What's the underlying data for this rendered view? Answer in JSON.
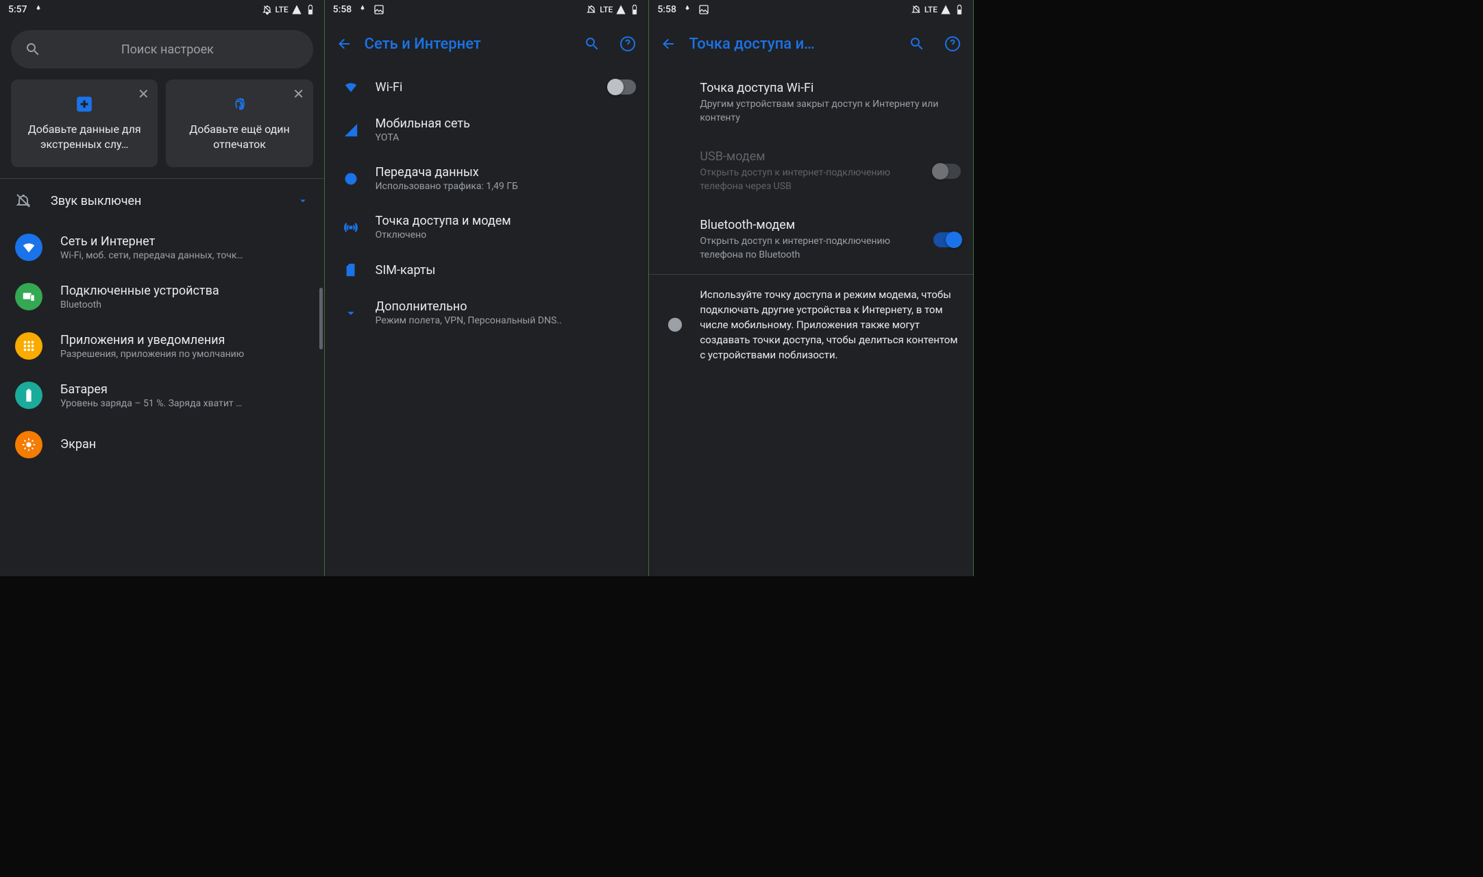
{
  "screen1": {
    "status": {
      "time": "5:57",
      "network": "LTE"
    },
    "search_placeholder": "Поиск настроек",
    "cards": [
      {
        "title": "Добавьте данные для экстренных слу…"
      },
      {
        "title": "Добавьте ещё один отпечаток"
      }
    ],
    "mute_label": "Звук выключен",
    "items": [
      {
        "title": "Сеть и Интернет",
        "sub": "Wi-Fi, моб. сети, передача данных, точк…",
        "color": "#1a73e8",
        "icon": "wifi"
      },
      {
        "title": "Подключенные устройства",
        "sub": "Bluetooth",
        "color": "#34a853",
        "icon": "devices"
      },
      {
        "title": "Приложения и уведомления",
        "sub": "Разрешения, приложения по умолчанию",
        "color": "#f9ab00",
        "icon": "apps"
      },
      {
        "title": "Батарея",
        "sub": "Уровень заряда – 51 %. Заряда хватит …",
        "color": "#1aab9b",
        "icon": "battery"
      },
      {
        "title": "Экран",
        "sub": "",
        "color": "#f57c00",
        "icon": "display"
      }
    ]
  },
  "screen2": {
    "status": {
      "time": "5:58",
      "network": "LTE"
    },
    "title": "Сеть и Интернет",
    "items": [
      {
        "title": "Wi-Fi",
        "sub": "",
        "icon": "wifi",
        "toggle": false
      },
      {
        "title": "Мобильная сеть",
        "sub": "YOTA",
        "icon": "signal"
      },
      {
        "title": "Передача данных",
        "sub": "Использовано трафика: 1,49 ГБ",
        "icon": "ring"
      },
      {
        "title": "Точка доступа и модем",
        "sub": "Отключено",
        "icon": "hotspot"
      },
      {
        "title": "SIM-карты",
        "sub": "",
        "icon": "sim"
      },
      {
        "title": "Дополнительно",
        "sub": "Режим полета, VPN, Персональный DNS..",
        "icon": "expand"
      }
    ]
  },
  "screen3": {
    "status": {
      "time": "5:58",
      "network": "LTE"
    },
    "title": "Точка доступа и…",
    "items": [
      {
        "title": "Точка доступа Wi-Fi",
        "sub": "Другим устройствам закрыт доступ к Интернету или контенту"
      },
      {
        "title": "USB-модем",
        "sub": "Открыть доступ к интернет-подключению телефона через USB",
        "disabled": true,
        "toggle": false
      },
      {
        "title": "Bluetooth-модем",
        "sub": "Открыть доступ к интернет-подключению телефона по Bluetooth",
        "toggle": true
      }
    ],
    "info": "Используйте точку доступа и режим модема, чтобы подключать другие устройства к Интернету, в том числе мобильному. Приложения также могут создавать точки доступа, чтобы делиться контентом с устройствами поблизости."
  }
}
